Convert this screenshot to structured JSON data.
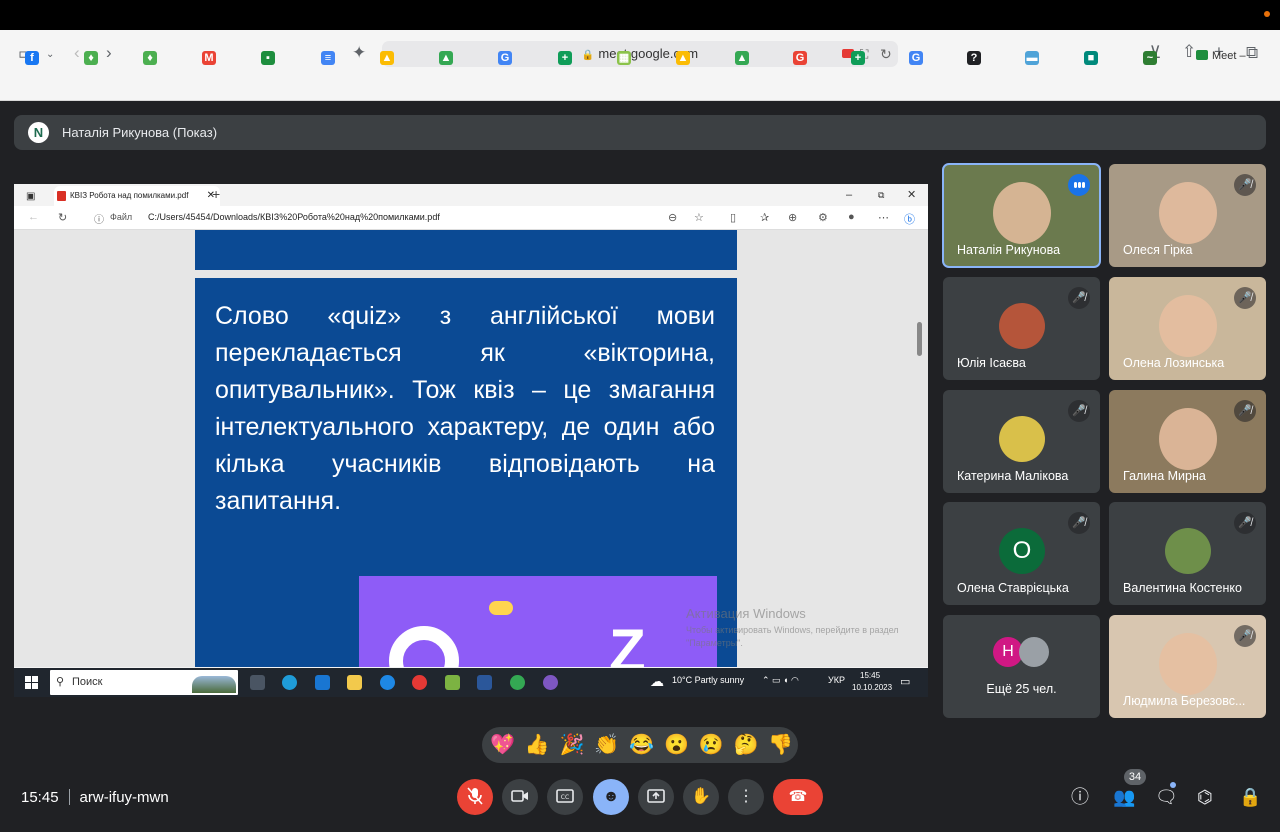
{
  "safari": {
    "url": "meet.google.com",
    "tab_label": "Meet –",
    "bookmarks": [
      {
        "icon": "facebook-icon",
        "glyph": "f",
        "color": "#1877f2"
      },
      {
        "icon": "bookmark-green-icon",
        "glyph": "♦",
        "color": "#4caf50"
      },
      {
        "icon": "bookmark-green-icon",
        "glyph": "♦",
        "color": "#4caf50"
      },
      {
        "icon": "gmail-icon",
        "glyph": "M",
        "color": "#ea4335"
      },
      {
        "icon": "classroom-icon",
        "glyph": "▪",
        "color": "#1e8e3e"
      },
      {
        "icon": "docs-icon",
        "glyph": "≡",
        "color": "#4285f4"
      },
      {
        "icon": "drive-icon",
        "glyph": "▲",
        "color": "#fbbc04"
      },
      {
        "icon": "drive-icon",
        "glyph": "▲",
        "color": "#34a853"
      },
      {
        "icon": "google-icon",
        "glyph": "G",
        "color": "#4285f4"
      },
      {
        "icon": "sheets-icon",
        "glyph": "+",
        "color": "#0f9d58"
      },
      {
        "icon": "image-icon",
        "glyph": "▦",
        "color": "#8bc34a"
      },
      {
        "icon": "drive-icon",
        "glyph": "▲",
        "color": "#fbbc04"
      },
      {
        "icon": "drive-icon",
        "glyph": "▲",
        "color": "#34a853"
      },
      {
        "icon": "google-icon",
        "glyph": "G",
        "color": "#ea4335"
      },
      {
        "icon": "sheets-icon",
        "glyph": "+",
        "color": "#0f9d58"
      },
      {
        "icon": "google-icon",
        "glyph": "G",
        "color": "#4285f4"
      },
      {
        "icon": "help-icon",
        "glyph": "?",
        "color": "#202124"
      },
      {
        "icon": "web-icon",
        "glyph": "▬",
        "color": "#4fa3d8"
      },
      {
        "icon": "meet-icon",
        "glyph": "■",
        "color": "#00897b"
      },
      {
        "icon": "boat-icon",
        "glyph": "~",
        "color": "#2e7d32"
      }
    ]
  },
  "presenter": {
    "initial": "N",
    "label": "Наталія Рикунова (Показ)"
  },
  "shared_screen": {
    "tab_title": "КВІЗ Робота над помилками.pdf",
    "file_label": "Файл",
    "path": "C:/Users/45454/Downloads/КВІЗ%20Робота%20над%20помилками.pdf",
    "slide_text": "Слово «quiz» з англійської мови перекладається як «вікторина, опитувальник». Тож квіз – це змагання інтелектуального характеру, де один або кілька учасників відповідають на запитання.",
    "watermark_title": "Активация Windows",
    "watermark_body": "Чтобы активировать Windows, перейдите в раздел \"Параметры\".",
    "taskbar": {
      "search_placeholder": "Поиск",
      "weather": "10°C  Partly sunny",
      "lang": "УКР",
      "time": "15:45",
      "date": "10.10.2023"
    }
  },
  "participants": [
    {
      "name": "Наталія Рикунова",
      "speaking": true,
      "bg": "#6b7a4e",
      "type": "video"
    },
    {
      "name": "Олеся Гірка",
      "speaking": false,
      "bg": "#a89a86",
      "type": "video"
    },
    {
      "name": "Юлія Ісаєва",
      "speaking": false,
      "bg": "#3c4043",
      "type": "avatar",
      "avatar_color": "#b5553a"
    },
    {
      "name": "Олена Лозинська",
      "speaking": false,
      "bg": "#c9b79b",
      "type": "video"
    },
    {
      "name": "Катерина Малікова",
      "speaking": false,
      "bg": "#3c4043",
      "type": "avatar",
      "avatar_color": "#d9c04a"
    },
    {
      "name": "Галина Мирна",
      "speaking": false,
      "bg": "#8c7a5e",
      "type": "video"
    },
    {
      "name": "Олена Ставрієцька",
      "speaking": false,
      "bg": "#3c4043",
      "type": "letter",
      "letter": "О",
      "avatar_color": "#0b6b3a"
    },
    {
      "name": "Валентина Костенко",
      "speaking": false,
      "bg": "#3c4043",
      "type": "avatar",
      "avatar_color": "#6e8f4a"
    },
    {
      "name": "Ещё 25 чел.",
      "type": "more",
      "bg": "#3c4043",
      "letter": "Н",
      "avatar_color": "#d01884"
    },
    {
      "name": "Людмила Березовс...",
      "speaking": false,
      "bg": "#d8c6b0",
      "type": "video"
    }
  ],
  "reactions": [
    "💖",
    "👍",
    "🎉",
    "👏",
    "😂",
    "😮",
    "😢",
    "🤔",
    "👎"
  ],
  "controls": {
    "time": "15:45",
    "meeting_code": "arw-ifuy-mwn",
    "people_count": "34"
  }
}
